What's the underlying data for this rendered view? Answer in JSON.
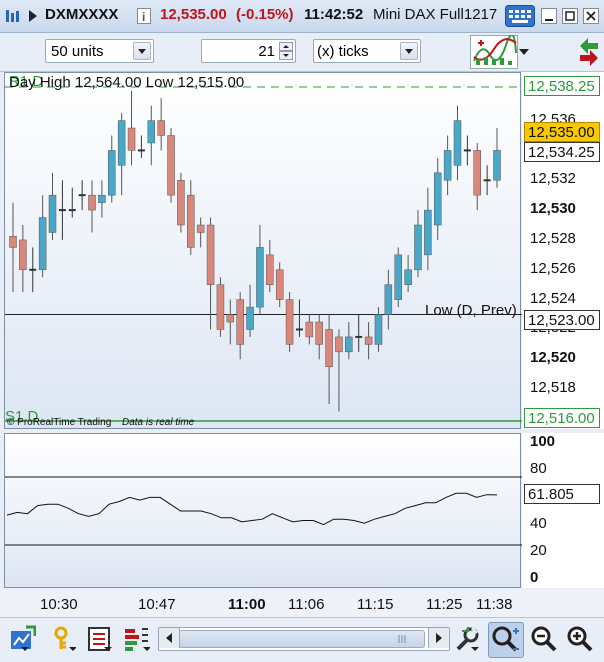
{
  "titlebar": {
    "symbol": "DXMXXXX",
    "price": "12,535.00",
    "change": "(-0.15%)",
    "time": "11:42:52",
    "instrument": "Mini DAX Full1217"
  },
  "toolbar": {
    "units_value": "50 units",
    "ticks_value": "21",
    "ticks_mode": "(x) ticks"
  },
  "chart": {
    "day_info": "Day High 12,564.00 Low 12,515.00",
    "low_label": "Low (D, Prev)",
    "r1_label": "R1 D",
    "s1_label": "S1 D",
    "watermark": "© ProRealTime Trading",
    "realtime": "Data is real time",
    "prices": {
      "r1": "12,538.25",
      "last": "12,535.00",
      "bid": "12,534.25",
      "low_prev": "12,523.00",
      "s1": "12,516.00"
    }
  },
  "y_axis": [
    "12,536",
    "12,532",
    "12,530",
    "12,528",
    "12,526",
    "12,524",
    "12,522",
    "12,520",
    "12,518"
  ],
  "indicator": {
    "value": "61.805",
    "levels": [
      "100",
      "80",
      "60",
      "40",
      "20",
      "0"
    ]
  },
  "x_axis": [
    "10:30",
    "10:47",
    "11:00",
    "11:06",
    "11:15",
    "11:25",
    "11:38"
  ],
  "colors": {
    "up": "#4aa7c8",
    "down": "#d9877a",
    "accent_green": "#2e9a3a",
    "title_red": "#c0141a"
  },
  "chart_data": {
    "type": "candlestick",
    "ylim": [
      12516,
      12538.25
    ],
    "candles": [
      {
        "o": 12528.25,
        "c": 12527.5,
        "h": 12530.5,
        "l": 12524.5
      },
      {
        "o": 12528,
        "c": 12526,
        "h": 12529,
        "l": 12524.5
      },
      {
        "o": 12526,
        "c": 12526,
        "h": 12527.5,
        "l": 12524.5
      },
      {
        "o": 12526,
        "c": 12529.5,
        "h": 12531,
        "l": 12525.5
      },
      {
        "o": 12528.5,
        "c": 12531,
        "h": 12532.5,
        "l": 12528
      },
      {
        "o": 12530,
        "c": 12530,
        "h": 12532,
        "l": 12528
      },
      {
        "o": 12530,
        "c": 12530,
        "h": 12531.5,
        "l": 12529.5
      },
      {
        "o": 12531,
        "c": 12531,
        "h": 12532,
        "l": 12530
      },
      {
        "o": 12531,
        "c": 12530,
        "h": 12532,
        "l": 12528.5
      },
      {
        "o": 12530.5,
        "c": 12531,
        "h": 12532,
        "l": 12529.5
      },
      {
        "o": 12531,
        "c": 12534,
        "h": 12535,
        "l": 12530.5
      },
      {
        "o": 12533,
        "c": 12536,
        "h": 12536.5,
        "l": 12531
      },
      {
        "o": 12535.5,
        "c": 12534,
        "h": 12538,
        "l": 12533
      },
      {
        "o": 12534,
        "c": 12534,
        "h": 12535,
        "l": 12533.5
      },
      {
        "o": 12534.5,
        "c": 12536,
        "h": 12537,
        "l": 12533
      },
      {
        "o": 12536,
        "c": 12535,
        "h": 12537.5,
        "l": 12534
      },
      {
        "o": 12535,
        "c": 12531,
        "h": 12535.5,
        "l": 12530.5
      },
      {
        "o": 12532,
        "c": 12529,
        "h": 12532.5,
        "l": 12528.5
      },
      {
        "o": 12531,
        "c": 12527.5,
        "h": 12532,
        "l": 12527
      },
      {
        "o": 12529,
        "c": 12528.5,
        "h": 12529.5,
        "l": 12527.5
      },
      {
        "o": 12529,
        "c": 12525,
        "h": 12529.5,
        "l": 12522
      },
      {
        "o": 12525,
        "c": 12522,
        "h": 12525.5,
        "l": 12521.5
      },
      {
        "o": 12523,
        "c": 12522.5,
        "h": 12524,
        "l": 12521
      },
      {
        "o": 12524,
        "c": 12521,
        "h": 12524.5,
        "l": 12520
      },
      {
        "o": 12522,
        "c": 12523.5,
        "h": 12525,
        "l": 12521.5
      },
      {
        "o": 12523.5,
        "c": 12527.5,
        "h": 12529,
        "l": 12523
      },
      {
        "o": 12527,
        "c": 12525,
        "h": 12528,
        "l": 12524.5
      },
      {
        "o": 12526,
        "c": 12524,
        "h": 12526.5,
        "l": 12523.5
      },
      {
        "o": 12524,
        "c": 12521,
        "h": 12524.5,
        "l": 12520.5
      },
      {
        "o": 12522,
        "c": 12522,
        "h": 12524,
        "l": 12521.5
      },
      {
        "o": 12522.5,
        "c": 12521.5,
        "h": 12523,
        "l": 12521
      },
      {
        "o": 12522.5,
        "c": 12521,
        "h": 12523,
        "l": 12520
      },
      {
        "o": 12522,
        "c": 12519.5,
        "h": 12523,
        "l": 12517
      },
      {
        "o": 12521.5,
        "c": 12520.5,
        "h": 12522,
        "l": 12516.5
      },
      {
        "o": 12520.5,
        "c": 12521.5,
        "h": 12522.5,
        "l": 12520
      },
      {
        "o": 12521.5,
        "c": 12521.5,
        "h": 12523,
        "l": 12520.5
      },
      {
        "o": 12521.5,
        "c": 12521,
        "h": 12522.5,
        "l": 12520
      },
      {
        "o": 12521,
        "c": 12523,
        "h": 12523.5,
        "l": 12520.5
      },
      {
        "o": 12523,
        "c": 12525,
        "h": 12526,
        "l": 12522
      },
      {
        "o": 12524,
        "c": 12527,
        "h": 12527.5,
        "l": 12523.5
      },
      {
        "o": 12525,
        "c": 12526,
        "h": 12527,
        "l": 12524.5
      },
      {
        "o": 12526,
        "c": 12529,
        "h": 12530,
        "l": 12525.5
      },
      {
        "o": 12527,
        "c": 12530,
        "h": 12531.5,
        "l": 12526
      },
      {
        "o": 12529,
        "c": 12532.5,
        "h": 12533.5,
        "l": 12528
      },
      {
        "o": 12532,
        "c": 12534,
        "h": 12535,
        "l": 12531
      },
      {
        "o": 12533,
        "c": 12536,
        "h": 12537,
        "l": 12532
      },
      {
        "o": 12534,
        "c": 12534,
        "h": 12535,
        "l": 12533
      },
      {
        "o": 12534,
        "c": 12531,
        "h": 12534.5,
        "l": 12530
      },
      {
        "o": 12532,
        "c": 12532,
        "h": 12533,
        "l": 12531
      },
      {
        "o": 12532,
        "c": 12534,
        "h": 12535.5,
        "l": 12531.5
      }
    ],
    "indicator_series": [
      47,
      49,
      48,
      54,
      55,
      55,
      52,
      48,
      46,
      48,
      55,
      57,
      60,
      58,
      60,
      60,
      55,
      50,
      50,
      50,
      48,
      45,
      45,
      42,
      43,
      44,
      48,
      45,
      42,
      43,
      43,
      40,
      44,
      44,
      43,
      41,
      44,
      46,
      48,
      52,
      54,
      56,
      56,
      60,
      63,
      63,
      60,
      62,
      61.805
    ],
    "indicator_levels": [
      75,
      25
    ]
  }
}
